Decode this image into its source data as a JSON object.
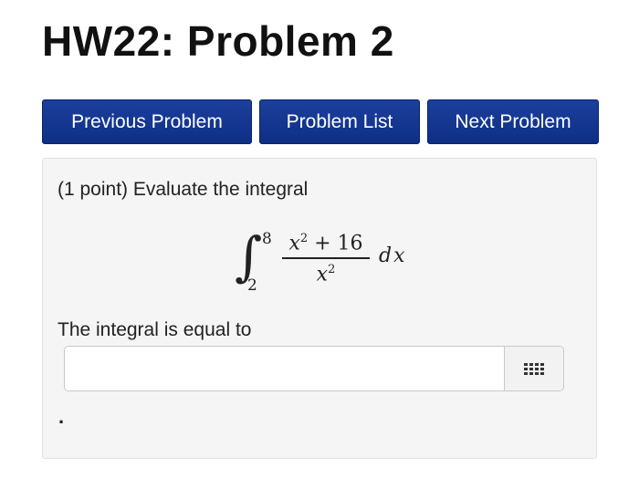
{
  "page": {
    "title": "HW22: Problem 2"
  },
  "nav": {
    "previous_label": "Previous Problem",
    "list_label": "Problem List",
    "next_label": "Next Problem",
    "button_color": "#12348f"
  },
  "problem": {
    "prompt": "(1 point) Evaluate the integral",
    "integral": {
      "upper_bound": "8",
      "lower_bound": "2",
      "numerator": {
        "base": "x",
        "exponent": "2",
        "rest": " + 16"
      },
      "denominator": {
        "base": "x",
        "exponent": "2"
      },
      "differential": "dx"
    },
    "answer_label": "The integral is equal to",
    "answer_value": "",
    "answer_placeholder": "",
    "answer_button_icon": "grid-icon",
    "trailing_text": "."
  }
}
